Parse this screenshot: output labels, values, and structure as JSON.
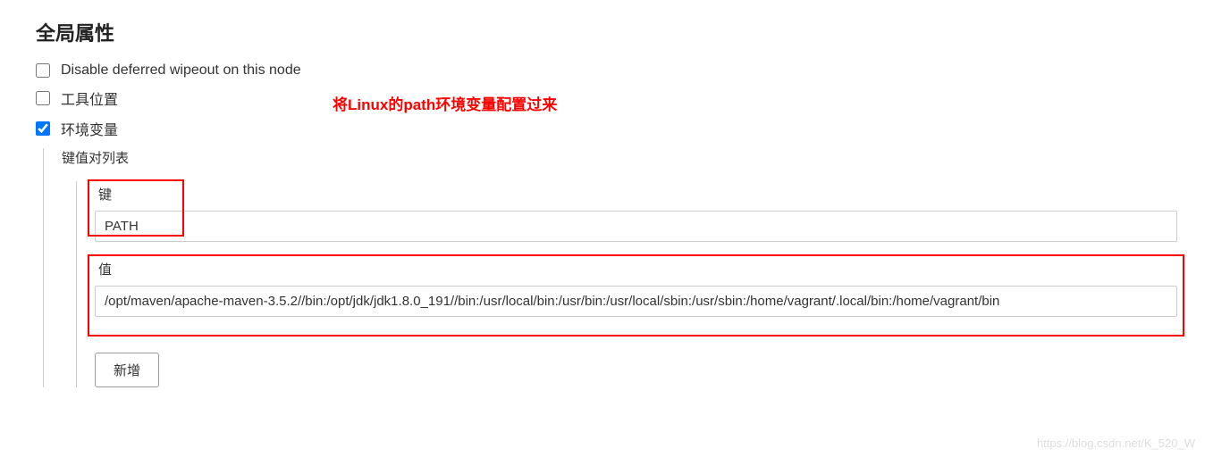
{
  "section": {
    "title": "全局属性"
  },
  "checkboxes": {
    "disable_wipeout": {
      "label": "Disable deferred wipeout on this node",
      "checked": false
    },
    "tool_location": {
      "label": "工具位置",
      "checked": false
    },
    "env_vars": {
      "label": "环境变量",
      "checked": true
    }
  },
  "annotation": {
    "text": "将Linux的path环境变量配置过来"
  },
  "env_section": {
    "list_label": "键值对列表",
    "key_label": "键",
    "key_value": "PATH",
    "value_label": "值",
    "value_value": "/opt/maven/apache-maven-3.5.2//bin:/opt/jdk/jdk1.8.0_191//bin:/usr/local/bin:/usr/bin:/usr/local/sbin:/usr/sbin:/home/vagrant/.local/bin:/home/vagrant/bin"
  },
  "buttons": {
    "add": "新增"
  },
  "watermark": "https://blog.csdn.net/K_520_W"
}
